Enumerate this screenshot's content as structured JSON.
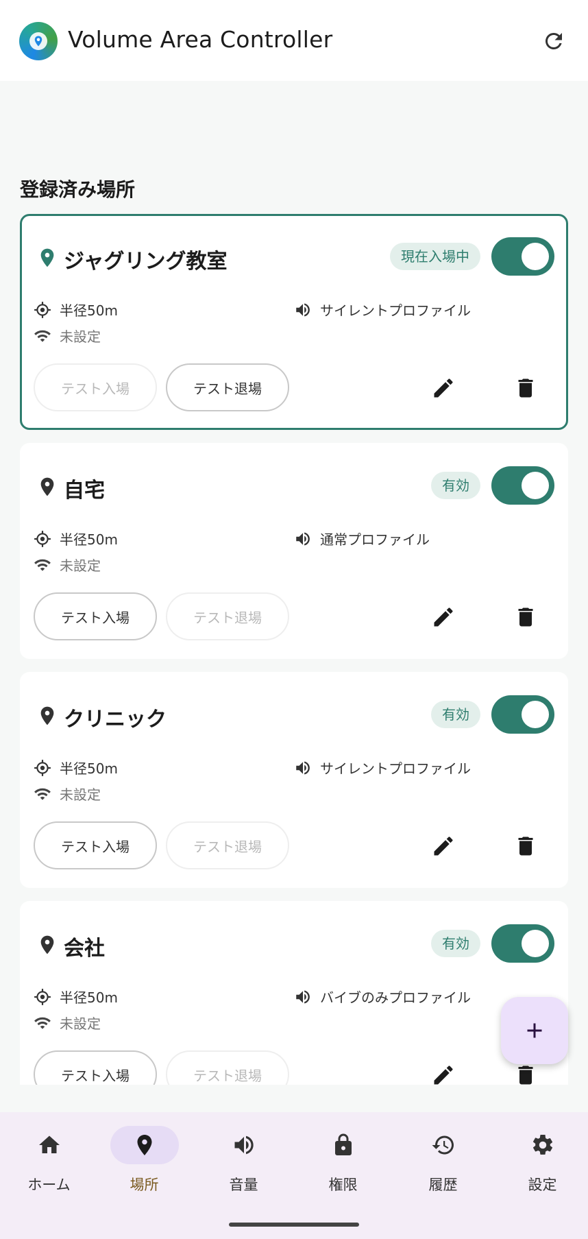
{
  "app": {
    "title": "Volume Area Controller"
  },
  "section_title": "登録済み場所",
  "places": [
    {
      "name": "ジャグリング教室",
      "status": "現在入場中",
      "enabled": true,
      "active": true,
      "radius": "半径50m",
      "wifi": "未設定",
      "profile": "サイレントプロファイル",
      "enter_label": "テスト入場",
      "exit_label": "テスト退場",
      "enter_enabled": false,
      "exit_enabled": true
    },
    {
      "name": "自宅",
      "status": "有効",
      "enabled": true,
      "active": false,
      "radius": "半径50m",
      "wifi": "未設定",
      "profile": "通常プロファイル",
      "enter_label": "テスト入場",
      "exit_label": "テスト退場",
      "enter_enabled": true,
      "exit_enabled": false
    },
    {
      "name": "クリニック",
      "status": "有効",
      "enabled": true,
      "active": false,
      "radius": "半径50m",
      "wifi": "未設定",
      "profile": "サイレントプロファイル",
      "enter_label": "テスト入場",
      "exit_label": "テスト退場",
      "enter_enabled": true,
      "exit_enabled": false
    },
    {
      "name": "会社",
      "status": "有効",
      "enabled": true,
      "active": false,
      "radius": "半径50m",
      "wifi": "未設定",
      "profile": "バイブのみプロファイル",
      "enter_label": "テスト入場",
      "exit_label": "テスト退場",
      "enter_enabled": true,
      "exit_enabled": false
    }
  ],
  "nav": [
    {
      "label": "ホーム",
      "icon": "home-icon",
      "selected": false
    },
    {
      "label": "場所",
      "icon": "location-pin-icon",
      "selected": true
    },
    {
      "label": "音量",
      "icon": "volume-icon",
      "selected": false
    },
    {
      "label": "権限",
      "icon": "lock-icon",
      "selected": false
    },
    {
      "label": "履歴",
      "icon": "history-icon",
      "selected": false
    },
    {
      "label": "設定",
      "icon": "settings-gear-icon",
      "selected": false
    }
  ],
  "colors": {
    "accent": "#2e7d6e",
    "badge_bg": "#e3efeb",
    "fab_bg": "#ece0fb",
    "nav_bg": "#f4edf7",
    "nav_selected": "#e6dcf5"
  }
}
